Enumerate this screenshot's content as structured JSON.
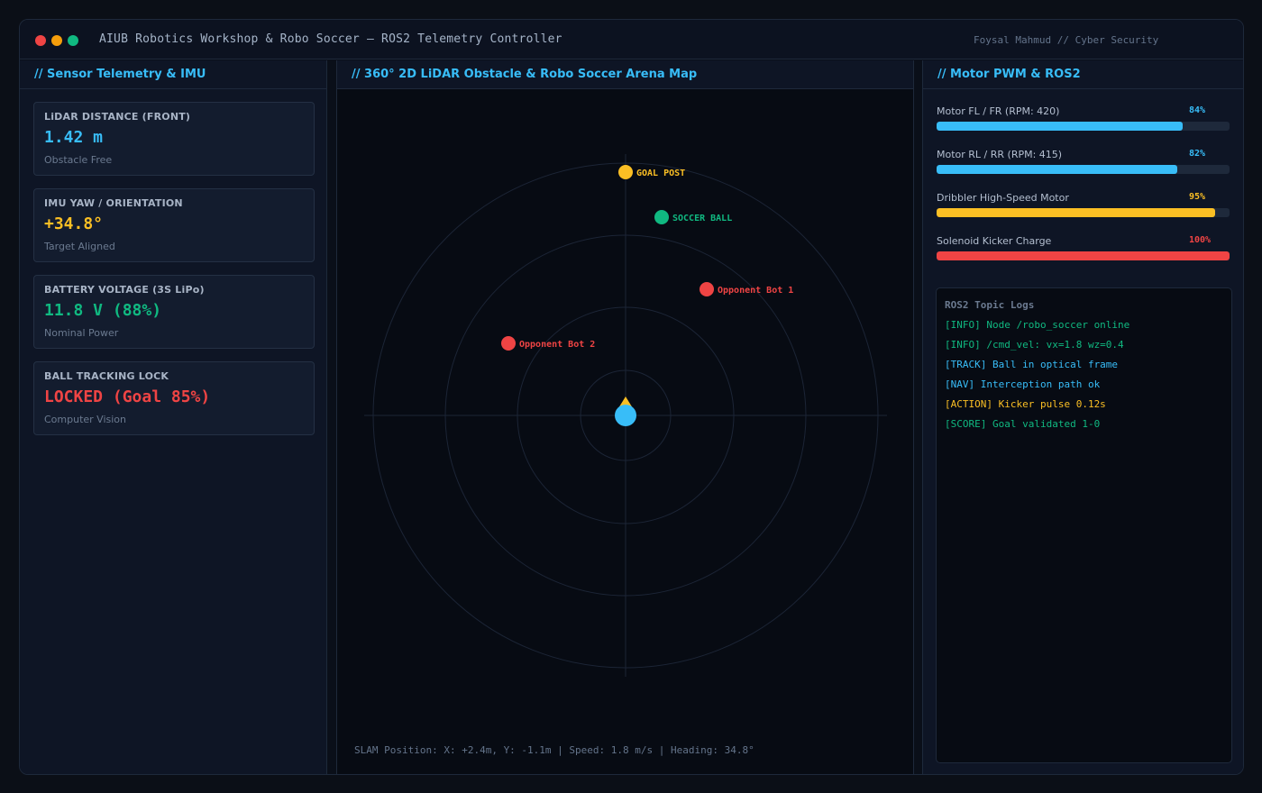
{
  "window": {
    "title": "AIUB Robotics Workshop & Robo Soccer — ROS2 Telemetry Controller",
    "author": "Foysal Mahmud // Cyber Security",
    "controls": [
      {
        "name": "close",
        "color": "#ef4444"
      },
      {
        "name": "minimize",
        "color": "#f59e0b"
      },
      {
        "name": "maximize",
        "color": "#10b981"
      }
    ]
  },
  "sensors": {
    "title": "// Sensor Telemetry & IMU",
    "cards": [
      {
        "label": "LiDAR DISTANCE (FRONT)",
        "value": "1.42 m",
        "status": "Obstacle Free",
        "color": "#38bdf8"
      },
      {
        "label": "IMU YAW / ORIENTATION",
        "value": "+34.8°",
        "status": "Target Aligned",
        "color": "#fbbf24"
      },
      {
        "label": "BATTERY VOLTAGE (3S LiPo)",
        "value": "11.8 V (88%)",
        "status": "Nominal Power",
        "color": "#10b981"
      },
      {
        "label": "BALL TRACKING LOCK",
        "value": "LOCKED (Goal 85%)",
        "status": "Computer Vision",
        "color": "#ef4444"
      }
    ]
  },
  "map": {
    "title": "// 360° 2D LiDAR Obstacle & Robo Soccer Arena Map",
    "objects": [
      {
        "label": "GOAL POST",
        "color": "#fbbf24"
      },
      {
        "label": "SOCCER BALL",
        "color": "#10b981"
      },
      {
        "label": "Opponent Bot 1",
        "color": "#ef4444"
      },
      {
        "label": "Opponent Bot 2",
        "color": "#ef4444"
      }
    ],
    "robot_color": "#38bdf8",
    "heading_marker_color": "#fbbf24",
    "status_line": "SLAM Position: X: +2.4m, Y: -1.1m | Speed: 1.8 m/s | Heading: 34.8°"
  },
  "motors": {
    "title": "// Motor PWM & ROS2",
    "items": [
      {
        "label": "Motor FL / FR (RPM: 420)",
        "percent_text": "84%",
        "level": 84,
        "color": "#38bdf8"
      },
      {
        "label": "Motor RL / RR (RPM: 415)",
        "percent_text": "82%",
        "level": 82,
        "color": "#38bdf8"
      },
      {
        "label": "Dribbler High-Speed Motor",
        "percent_text": "95%",
        "level": 95,
        "color": "#fbbf24"
      },
      {
        "label": "Solenoid Kicker Charge",
        "percent_text": "100%",
        "level": 100,
        "color": "#ef4444"
      }
    ]
  },
  "logs": {
    "title": "ROS2 Topic Logs",
    "lines": [
      {
        "text": "[INFO] Node /robo_soccer online",
        "color": "#10b981"
      },
      {
        "text": "[INFO] /cmd_vel: vx=1.8 wz=0.4",
        "color": "#10b981"
      },
      {
        "text": "[TRACK] Ball in optical frame",
        "color": "#38bdf8"
      },
      {
        "text": "[NAV] Interception path ok",
        "color": "#38bdf8"
      },
      {
        "text": "[ACTION] Kicker pulse 0.12s",
        "color": "#fbbf24"
      },
      {
        "text": "[SCORE] Goal validated 1-0",
        "color": "#10b981"
      }
    ]
  }
}
